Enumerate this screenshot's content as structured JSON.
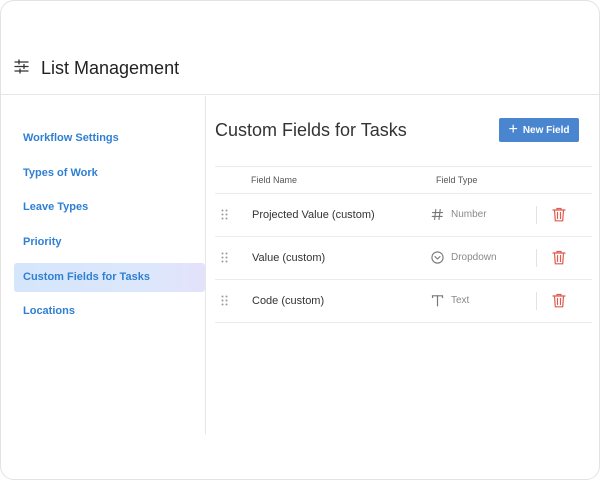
{
  "header": {
    "title": "List Management",
    "icon": "sliders-icon"
  },
  "sidebar": {
    "items": [
      {
        "label": "Workflow Settings"
      },
      {
        "label": "Types of Work"
      },
      {
        "label": "Leave Types"
      },
      {
        "label": "Priority"
      },
      {
        "label": "Custom Fields for Tasks",
        "active": true
      },
      {
        "label": "Locations"
      }
    ]
  },
  "main": {
    "title": "Custom Fields for Tasks",
    "new_field_label": "New Field",
    "columns": {
      "name": "Field Name",
      "type": "Field Type"
    },
    "rows": [
      {
        "name": "Projected Value (custom)",
        "type": "Number",
        "type_icon": "hash-icon"
      },
      {
        "name": "Value (custom)",
        "type": "Dropdown",
        "type_icon": "dropdown-circle-icon"
      },
      {
        "name": "Code (custom)",
        "type": "Text",
        "type_icon": "text-icon"
      }
    ]
  },
  "colors": {
    "accent": "#4a86cf",
    "link": "#2f7fd3",
    "delete": "#e05a4f",
    "active_bg": "#d8e6fb"
  }
}
